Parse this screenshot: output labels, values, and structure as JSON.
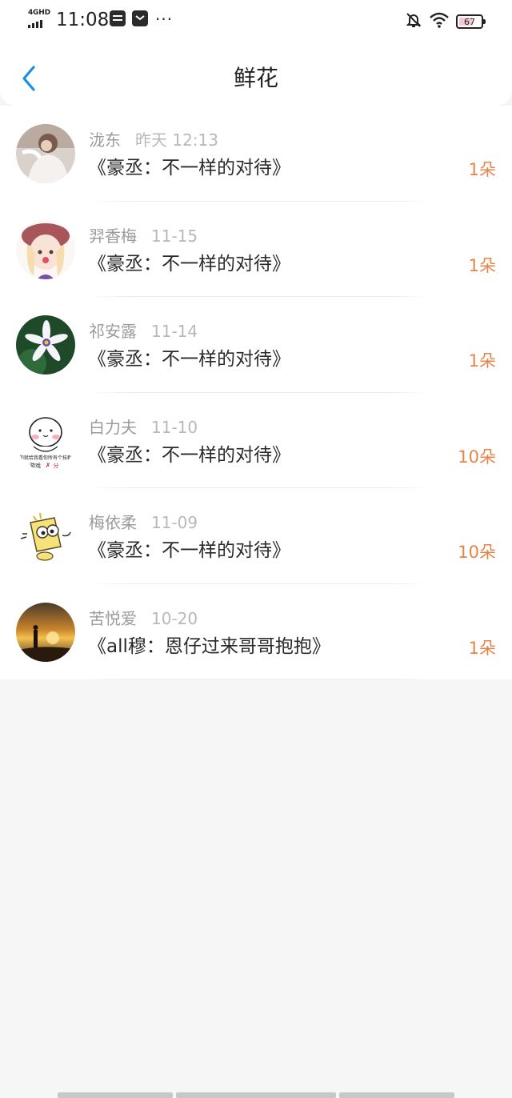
{
  "status_bar": {
    "network": "4GHD",
    "time": "11:08",
    "more": "···",
    "battery": "67"
  },
  "nav": {
    "title": "鲜花"
  },
  "colors": {
    "accent": "#1a8fe3",
    "flower_count": "#e8834a",
    "text_primary": "#2a2a2a",
    "text_secondary": "#9b9b9b"
  },
  "records": [
    {
      "name": "泷东",
      "date": "昨天 12:13",
      "book": "《豪丞：不一样的对待》",
      "count": "1朵"
    },
    {
      "name": "羿香梅",
      "date": "11-15",
      "book": "《豪丞：不一样的对待》",
      "count": "1朵"
    },
    {
      "name": "祁安露",
      "date": "11-14",
      "book": "《豪丞：不一样的对待》",
      "count": "1朵"
    },
    {
      "name": "白力夫",
      "date": "11-10",
      "book": "《豪丞：不一样的对待》",
      "count": "10朵"
    },
    {
      "name": "梅依柔",
      "date": "11-09",
      "book": "《豪丞：不一样的对待》",
      "count": "10朵"
    },
    {
      "name": "苦悦爱",
      "date": "10-20",
      "book": "《all穆：恩仔过来哥哥抱抱》",
      "count": "1朵"
    }
  ],
  "avatar_texts": {
    "sticker_line1": "你就给我看你所有个技群",
    "sticker_line2": "游戏",
    "sticker_line3": "分"
  }
}
